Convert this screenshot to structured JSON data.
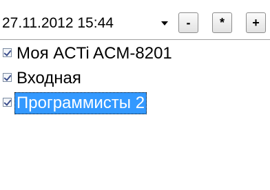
{
  "toolbar": {
    "datetime_value": "27.11.2012 15:44",
    "dropdown_arrow_icon": "chevron-down-icon",
    "minus_label": "-",
    "star_label": "*",
    "plus_label": "+"
  },
  "list": {
    "items": [
      {
        "label": "Моя ACTi ACM-8201",
        "checked": true,
        "selected": false
      },
      {
        "label": "Входная",
        "checked": true,
        "selected": false
      },
      {
        "label": "Программисты 2",
        "checked": true,
        "selected": true
      }
    ]
  },
  "colors": {
    "selection_bg": "#3399ff",
    "selection_text": "#ffffff"
  }
}
